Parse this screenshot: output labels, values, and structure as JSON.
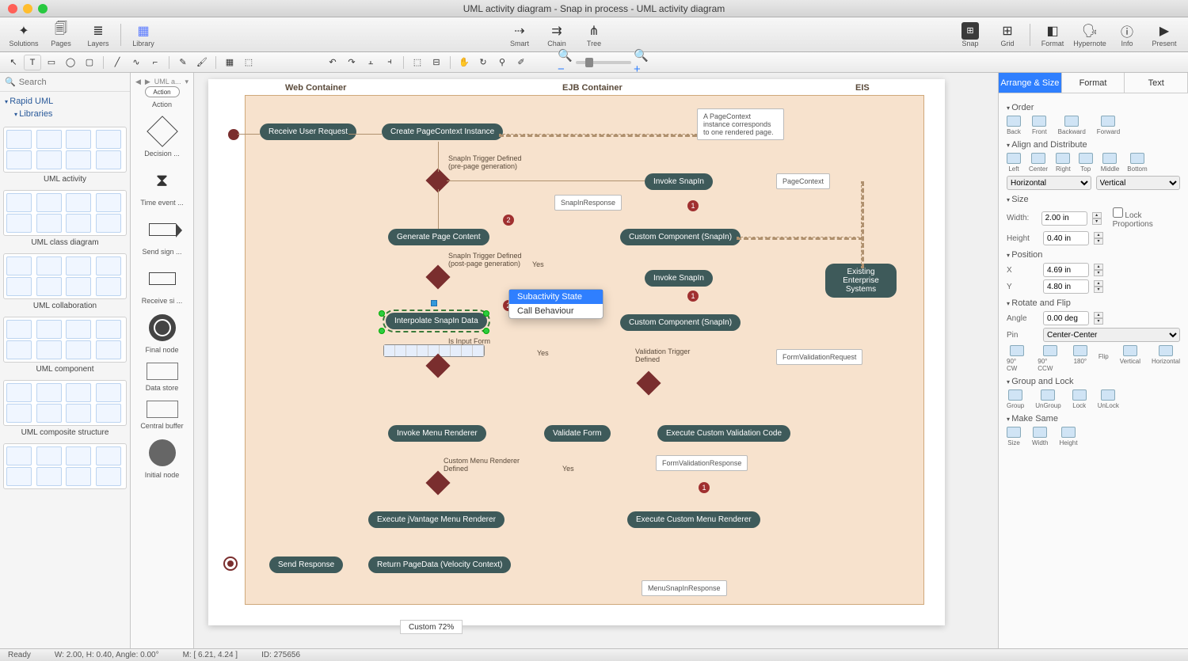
{
  "window": {
    "title": "UML activity diagram - Snap in process - UML activity diagram"
  },
  "toolbar": {
    "solutions": "Solutions",
    "pages": "Pages",
    "layers": "Layers",
    "library": "Library",
    "smart": "Smart",
    "chain": "Chain",
    "tree": "Tree",
    "snap": "Snap",
    "grid": "Grid",
    "format": "Format",
    "hypernote": "Hypernote",
    "info": "Info",
    "present": "Present"
  },
  "search": {
    "placeholder": "Search",
    "breadcrumb_tab": "UML a..."
  },
  "tree": {
    "root": "Rapid UML",
    "libraries": "Libraries"
  },
  "libraries": [
    {
      "title": "UML activity"
    },
    {
      "title": "UML class diagram"
    },
    {
      "title": "UML collaboration"
    },
    {
      "title": "UML component"
    },
    {
      "title": "UML composite structure"
    }
  ],
  "stencil": {
    "action_btn": "Action",
    "items": [
      "Action",
      "Decision ...",
      "Time event ...",
      "Send sign ...",
      "Receive si ...",
      "Final node",
      "Data store",
      "Central buffer",
      "Initial node"
    ]
  },
  "swimlanes": {
    "web": "Web Container",
    "ejb": "EJB Container",
    "eis": "EIS"
  },
  "nodes": {
    "receive": "Receive User Request",
    "create_ctx": "Create PageContext Instance",
    "invoke_snapin1": "Invoke SnapIn",
    "generate": "Generate Page Content",
    "custom1": "Custom Component (SnapIn)",
    "invoke_snapin2": "Invoke SnapIn",
    "custom2": "Custom Component (SnapIn)",
    "interpolate": "Interpolate SnapIn Data",
    "invoke_menu": "Invoke Menu Renderer",
    "validate": "Validate Form",
    "exec_valid": "Execute Custom Validation Code",
    "jvantage": "Execute jVantage Menu Renderer",
    "exec_custom_menu": "Execute Custom Menu Renderer",
    "return_pd": "Return PageData (Velocity Context)",
    "send_resp": "Send Response",
    "existing": "Existing Enterprise Systems"
  },
  "notes": {
    "pagecontext": "A PageContext instance corresponds to one rendered page.",
    "snapinresp": "SnapInResponse",
    "pagectx": "PageContext",
    "formvalreq": "FormValidationRequest",
    "formvalresp": "FormValidationResponse",
    "menusnap": "MenuSnapInResponse"
  },
  "labels": {
    "trig1": "SnapIn Trigger Defined\n(pre-page generation)",
    "trig2": "SnapIn Trigger Defined\n(post-page generation)",
    "yes1": "Yes",
    "yes2": "Yes",
    "yes3": "Yes",
    "isinput": "Is Input Form",
    "valtrig": "Validation Trigger\nDefined",
    "custmenu": "Custom Menu Renderer\nDefined"
  },
  "context_menu": {
    "subactivity": "Subactivity State",
    "callbehaviour": "Call Behaviour"
  },
  "zoom": "Custom 72%",
  "status": {
    "ready": "Ready",
    "wh": "W: 2.00,  H: 0.40,  Angle: 0.00°",
    "m": "M: [ 6.21, 4.24 ]",
    "id": "ID: 275656"
  },
  "right": {
    "tabs": {
      "arrange": "Arrange & Size",
      "format": "Format",
      "text": "Text"
    },
    "order": "Order",
    "order_items": [
      "Back",
      "Front",
      "Backward",
      "Forward"
    ],
    "align": "Align and Distribute",
    "align_items": [
      "Left",
      "Center",
      "Right",
      "Top",
      "Middle",
      "Bottom"
    ],
    "horiz": "Horizontal",
    "vert": "Vertical",
    "size": "Size",
    "width_l": "Width:",
    "width_v": "2.00 in",
    "height_l": "Height",
    "height_v": "0.40 in",
    "lock": "Lock Proportions",
    "position": "Position",
    "x_l": "X",
    "x_v": "4.69 in",
    "y_l": "Y",
    "y_v": "4.80 in",
    "rotate": "Rotate and Flip",
    "angle_l": "Angle",
    "angle_v": "0.00 deg",
    "pin_l": "Pin",
    "pin_v": "Center-Center",
    "rot_items": [
      "90° CW",
      "90° CCW",
      "180°"
    ],
    "flip": "Flip",
    "flip_items": [
      "Vertical",
      "Horizontal"
    ],
    "group": "Group and Lock",
    "group_items": [
      "Group",
      "UnGroup",
      "Lock",
      "UnLock"
    ],
    "makesame": "Make Same",
    "ms_items": [
      "Size",
      "Width",
      "Height"
    ]
  }
}
